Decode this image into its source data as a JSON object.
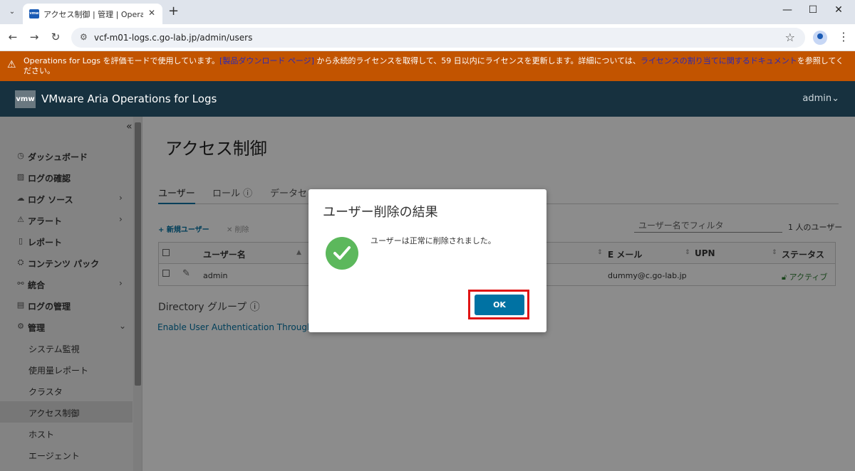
{
  "browser": {
    "tab_title": "アクセス制御 | 管理 | Operations",
    "tab_favicon_text": "vmw",
    "url": "vcf-m01-logs.c.go-lab.jp/admin/users"
  },
  "banner": {
    "text_1": "Operations for Logs を評価モードで使用しています。",
    "link_1": "[製品ダウンロード ページ]",
    "text_2": " から永続的ライセンスを取得して、59 日以内にライセンスを更新します。詳細については、",
    "link_2": "ライセンスの割り当てに関するドキュメント",
    "text_3": "を参照してください。"
  },
  "header": {
    "logo": "vmw",
    "app_title": "VMware Aria Operations for Logs",
    "user": "admin"
  },
  "sidebar": {
    "items": [
      {
        "label": "ダッシュボード"
      },
      {
        "label": "ログの確認"
      },
      {
        "label": "ログ ソース"
      },
      {
        "label": "アラート"
      },
      {
        "label": "レポート"
      },
      {
        "label": "コンテンツ パック"
      },
      {
        "label": "統合"
      },
      {
        "label": "ログの管理"
      },
      {
        "label": "管理"
      }
    ],
    "sub_items": [
      {
        "label": "システム監視"
      },
      {
        "label": "使用量レポート"
      },
      {
        "label": "クラスタ"
      },
      {
        "label": "アクセス制御"
      },
      {
        "label": "ホスト"
      },
      {
        "label": "エージェント"
      }
    ]
  },
  "main": {
    "title": "アクセス制御",
    "tabs": [
      {
        "label": "ユーザー"
      },
      {
        "label": "ロール ⓘ"
      },
      {
        "label": "データセ"
      }
    ],
    "new_user": "+ 新規ユーザー",
    "delete": "✕ 削除",
    "filter_placeholder": "ユーザー名でフィルタ",
    "user_count": "1 人のユーザー",
    "table": {
      "columns": {
        "username": "ユーザー名",
        "email": "E メール",
        "upn": "UPN",
        "status": "ステータス"
      },
      "rows": [
        {
          "username": "admin",
          "email": "dummy@c.go-lab.jp",
          "status": "アクティブ"
        }
      ]
    },
    "directory_groups": "Directory グループ ⓘ",
    "enable_link": "Enable User Authentication Through A"
  },
  "modal": {
    "title": "ユーザー削除の結果",
    "message": "ユーザーは正常に削除されました。",
    "ok": "OK"
  },
  "colors": {
    "banner": "#c25400",
    "header": "#17313f",
    "primary": "#0072a3",
    "success": "#5cb85c",
    "highlight": "#e01414"
  }
}
